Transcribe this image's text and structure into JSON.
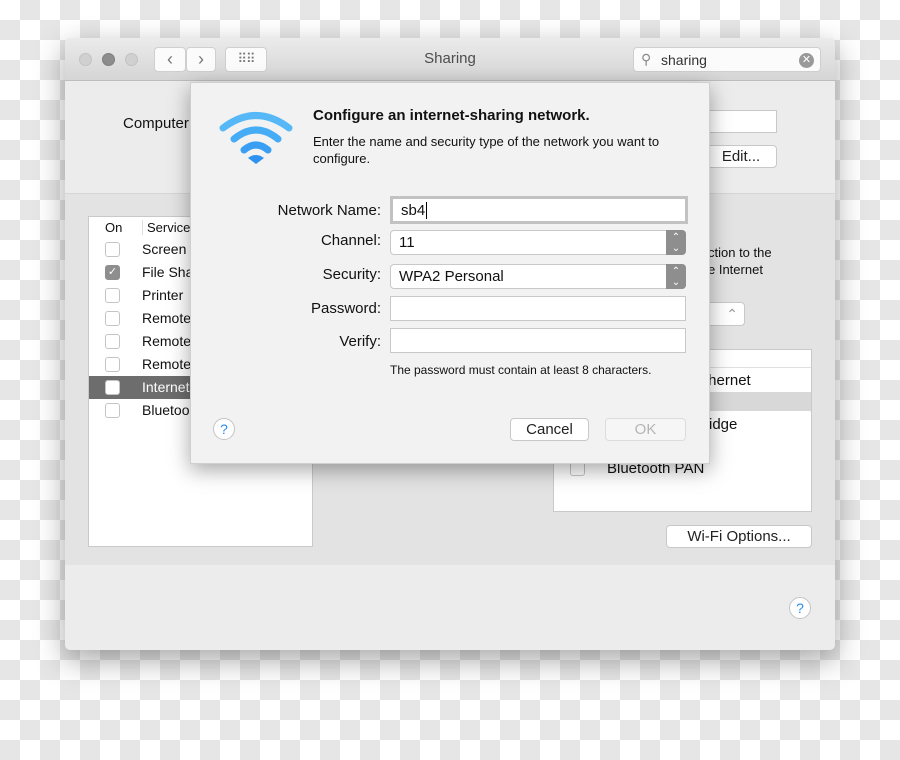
{
  "window": {
    "title": "Sharing",
    "search_value": "sharing"
  },
  "background": {
    "computer_name_label": "Computer",
    "edit_button": "Edit...",
    "services": {
      "header_on": "On",
      "header_service": "Service",
      "items": [
        {
          "label": "Screen",
          "checked": false
        },
        {
          "label": "File Sha",
          "checked": true
        },
        {
          "label": "Printer",
          "checked": false
        },
        {
          "label": "Remote",
          "checked": false
        },
        {
          "label": "Remote",
          "checked": false
        },
        {
          "label": "Remote",
          "checked": false
        },
        {
          "label": "Internet",
          "checked": false,
          "selected": true
        },
        {
          "label": "Bluetoo",
          "checked": false
        }
      ]
    },
    "right_text_1": "ction to the",
    "right_text_2": "e Internet",
    "popup_partial": "t",
    "ports": [
      "thernet",
      "",
      "ridge",
      "Bluetooth PAN"
    ],
    "wifi_options_button": "Wi-Fi Options..."
  },
  "dialog": {
    "title": "Configure an internet-sharing network.",
    "description": "Enter the name and security type of the network you want to configure.",
    "network_name_label": "Network Name:",
    "network_name_value": "sb4",
    "channel_label": "Channel:",
    "channel_value": "11",
    "security_label": "Security:",
    "security_value": "WPA2 Personal",
    "password_label": "Password:",
    "password_value": "",
    "verify_label": "Verify:",
    "verify_value": "",
    "hint": "The password must contain at least 8 characters.",
    "cancel_button": "Cancel",
    "ok_button": "OK",
    "help": "?"
  },
  "colors": {
    "wifi_icon": "#3fa9f5",
    "selection": "#6d6d6d"
  }
}
